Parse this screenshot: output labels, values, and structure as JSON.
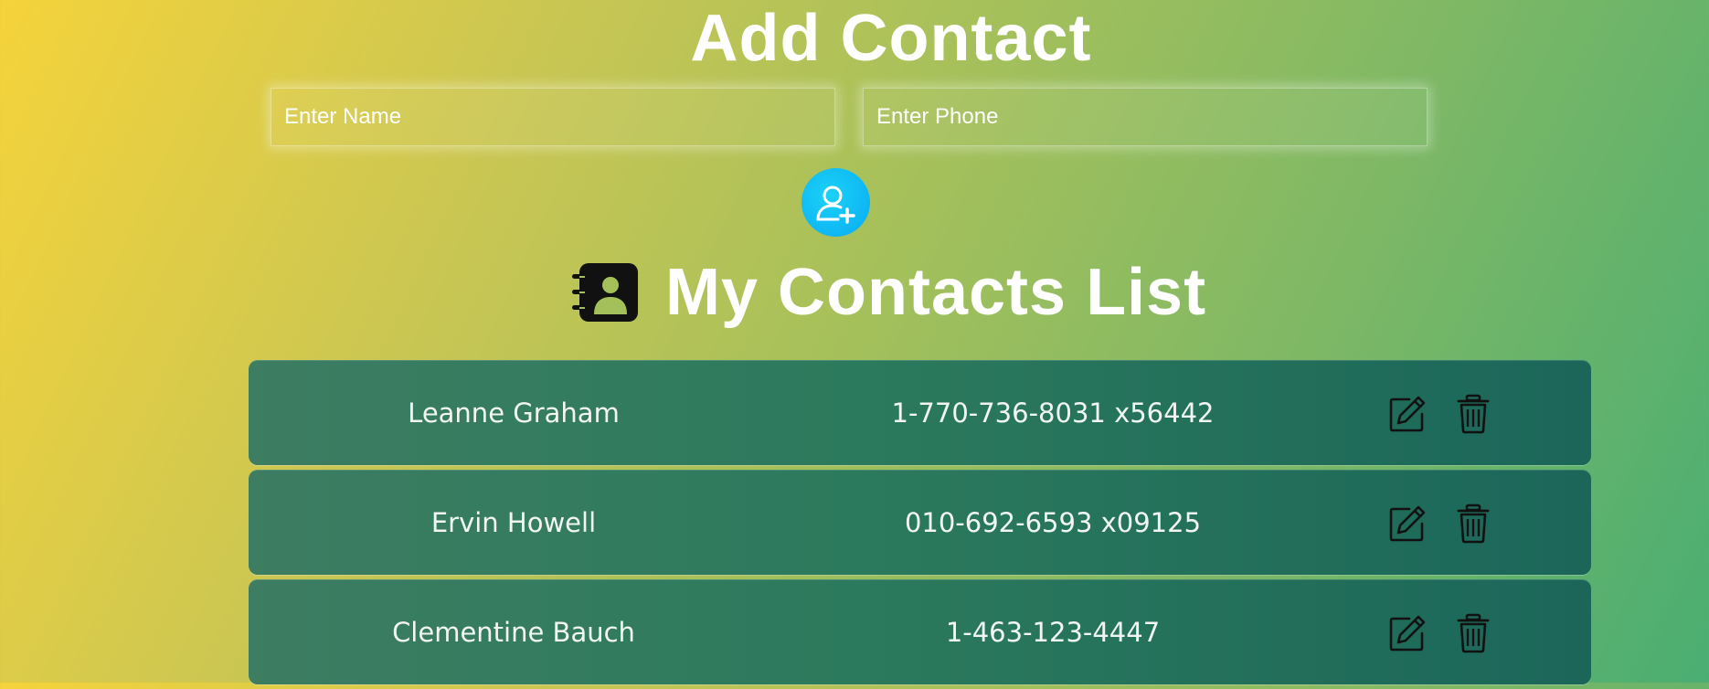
{
  "form": {
    "title": "Add Contact",
    "name_placeholder": "Enter Name",
    "phone_placeholder": "Enter Phone",
    "add_button_icon": "person-add-icon"
  },
  "list": {
    "title": "My Contacts List",
    "title_icon": "contact-book-icon",
    "row_actions": [
      "edit-icon",
      "trash-icon"
    ],
    "contacts": [
      {
        "name": "Leanne Graham",
        "phone": "1-770-736-8031 x56442"
      },
      {
        "name": "Ervin Howell",
        "phone": "010-692-6593 x09125"
      },
      {
        "name": "Clementine Bauch",
        "phone": "1-463-123-4447"
      }
    ]
  },
  "colors": {
    "add_button": "#0aaaf2",
    "row_background": "#2c7a5d",
    "title_text": "#ffffff"
  }
}
